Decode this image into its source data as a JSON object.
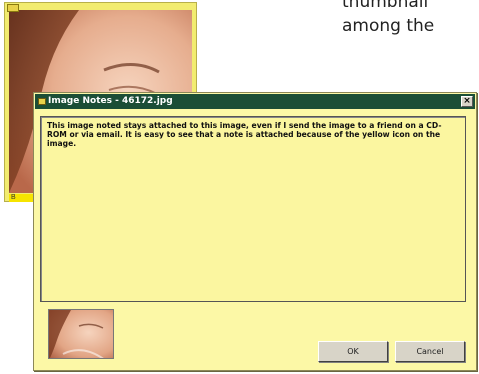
{
  "background_text": {
    "line1": "thumbnail",
    "line2": "among the"
  },
  "thumbnail": {
    "caption": "B"
  },
  "dialog": {
    "title": "Image Notes - 46172.jpg",
    "close_label": "×",
    "note_text": "This image noted stays attached to this image, even if I send the image to a friend on a CD-ROM or via email. It is easy to see that a note is attached because of the yellow icon on the image.",
    "ok_label": "OK",
    "cancel_label": "Cancel"
  },
  "colors": {
    "titlebar": "#1b4e36",
    "dialog_bg": "#fcf8a6",
    "thumbnail_frame": "#f2ec70",
    "note_icon": "#e8d24a"
  },
  "icons": {
    "title_icon": "note-icon",
    "thumbnail_marker": "note-icon",
    "close": "close-icon"
  }
}
